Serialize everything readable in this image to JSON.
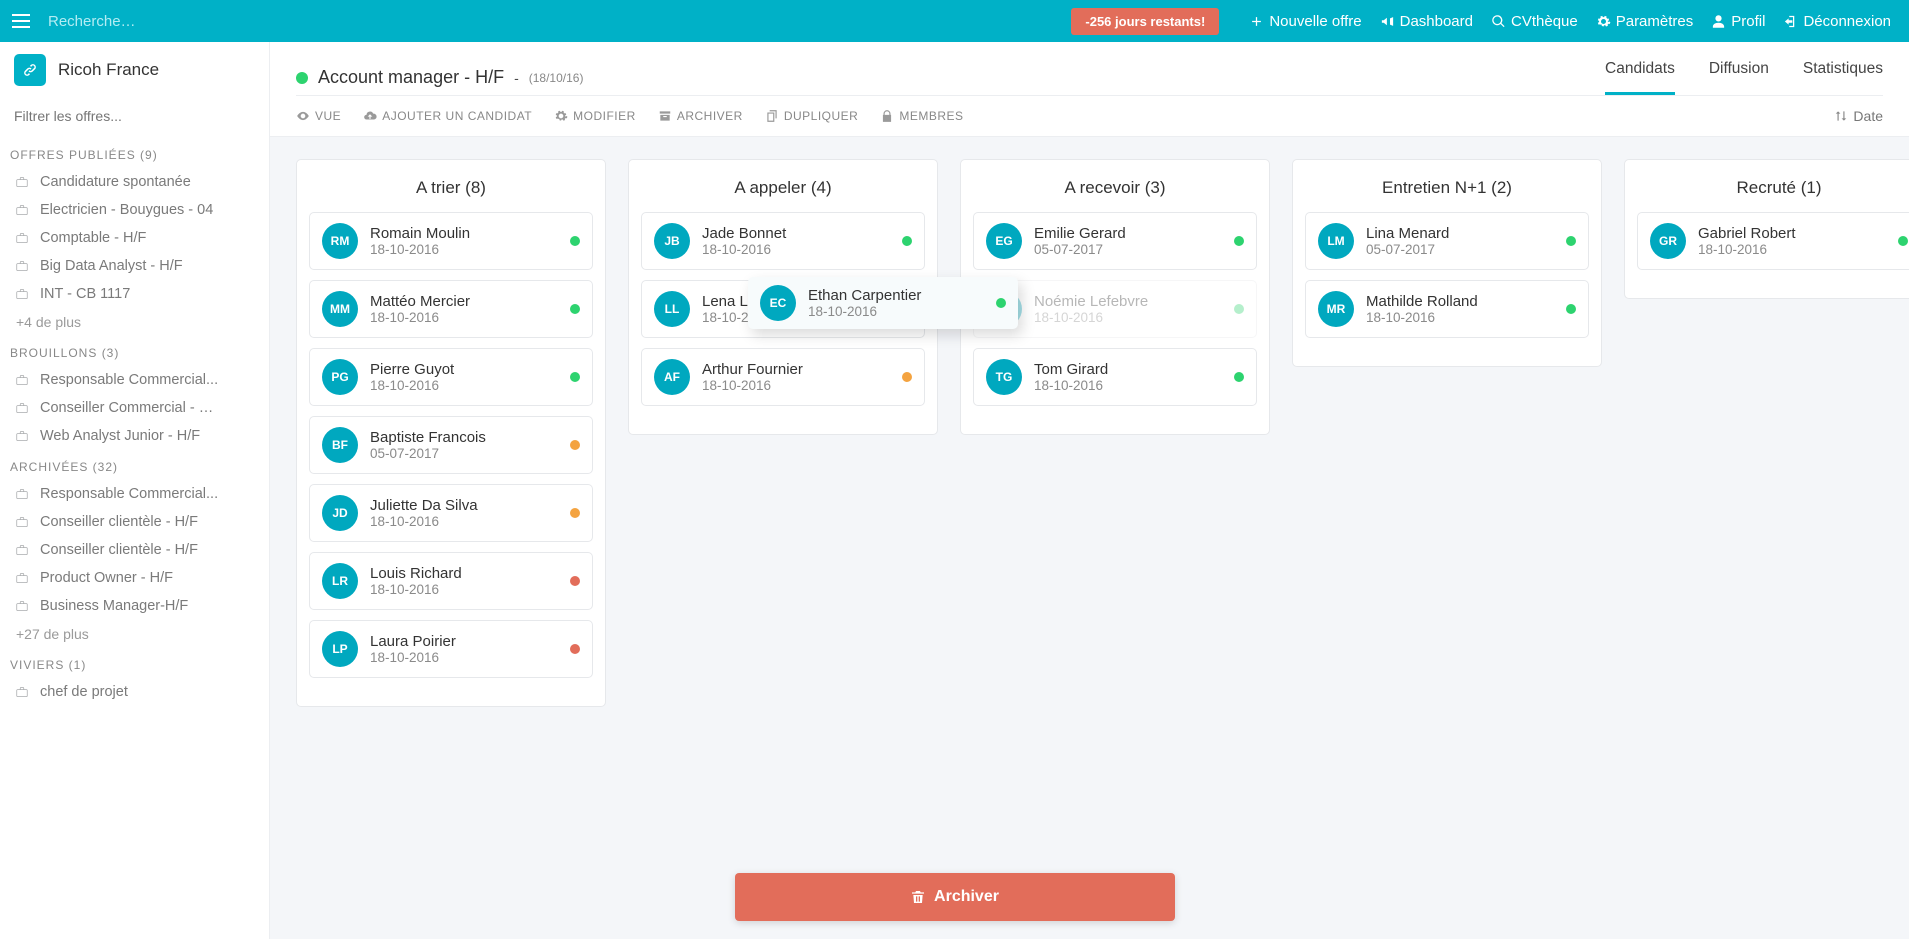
{
  "topbar": {
    "search_placeholder": "Recherche…",
    "days_badge": "-256 jours restants!",
    "nav": {
      "nouvelle": "Nouvelle offre",
      "dashboard": "Dashboard",
      "cv": "CVthèque",
      "params": "Paramètres",
      "profil": "Profil",
      "logout": "Déconnexion"
    }
  },
  "sidebar": {
    "org": "Ricoh France",
    "filter_placeholder": "Filtrer les offres...",
    "sections": {
      "publiees": {
        "title": "OFFRES PUBLIÉES (9)",
        "items": [
          "Candidature spontanée",
          "Electricien - Bouygues - 04",
          "Comptable - H/F",
          "Big Data Analyst - H/F",
          "INT - CB 1117"
        ],
        "more": "+4 de plus"
      },
      "brouillons": {
        "title": "BROUILLONS (3)",
        "items": [
          "Responsable Commercial...",
          "Conseiller Commercial - …",
          "Web Analyst Junior - H/F"
        ]
      },
      "archivees": {
        "title": "ARCHIVÉES (32)",
        "items": [
          "Responsable Commercial...",
          "Conseiller clientèle - H/F",
          "Conseiller clientèle - H/F",
          "Product Owner - H/F",
          "Business Manager-H/F"
        ],
        "more": "+27 de plus"
      },
      "viviers": {
        "title": "VIVIERS (1)",
        "items": [
          "chef de projet"
        ]
      }
    }
  },
  "job": {
    "title": "Account manager - H/F",
    "date": "(18/10/16)",
    "tabs": {
      "candidats": "Candidats",
      "diffusion": "Diffusion",
      "stats": "Statistiques"
    }
  },
  "toolbar": {
    "vue": "VUE",
    "ajouter": "AJOUTER UN CANDIDAT",
    "modifier": "MODIFIER",
    "archiver": "ARCHIVER",
    "dupliquer": "DUPLIQUER",
    "membres": "MEMBRES",
    "sort": "Date"
  },
  "kanban": {
    "columns": [
      {
        "id": "trier",
        "title": "A trier (8)",
        "cards": [
          {
            "init": "RM",
            "name": "Romain Moulin",
            "date": "18-10-2016",
            "dot": "green"
          },
          {
            "init": "MM",
            "name": "Mattéo Mercier",
            "date": "18-10-2016",
            "dot": "green"
          },
          {
            "init": "PG",
            "name": "Pierre Guyot",
            "date": "18-10-2016",
            "dot": "green"
          },
          {
            "init": "BF",
            "name": "Baptiste Francois",
            "date": "05-07-2017",
            "dot": "orange"
          },
          {
            "init": "JD",
            "name": "Juliette Da Silva",
            "date": "18-10-2016",
            "dot": "orange"
          },
          {
            "init": "LR",
            "name": "Louis Richard",
            "date": "18-10-2016",
            "dot": "red"
          },
          {
            "init": "LP",
            "name": "Laura Poirier",
            "date": "18-10-2016",
            "dot": "red"
          }
        ]
      },
      {
        "id": "appeler",
        "title": "A appeler (4)",
        "cards": [
          {
            "init": "JB",
            "name": "Jade Bonnet",
            "date": "18-10-2016",
            "dot": "green"
          },
          {
            "init": "LL",
            "name": "Lena Lucas",
            "date": "18-10-2016",
            "dot": "orange"
          },
          {
            "init": "AF",
            "name": "Arthur Fournier",
            "date": "18-10-2016",
            "dot": "orange"
          }
        ]
      },
      {
        "id": "recevoir",
        "title": "A recevoir (3)",
        "cards": [
          {
            "init": "EG",
            "name": "Emilie Gerard",
            "date": "05-07-2017",
            "dot": "green"
          },
          {
            "init": "NL",
            "name": "Noémie Lefebvre",
            "date": "18-10-2016",
            "dot": "green",
            "faded": true
          },
          {
            "init": "TG",
            "name": "Tom Girard",
            "date": "18-10-2016",
            "dot": "green"
          }
        ]
      },
      {
        "id": "entretien",
        "title": "Entretien N+1 (2)",
        "cards": [
          {
            "init": "LM",
            "name": "Lina Menard",
            "date": "05-07-2017",
            "dot": "green"
          },
          {
            "init": "MR",
            "name": "Mathilde Rolland",
            "date": "18-10-2016",
            "dot": "green"
          }
        ]
      },
      {
        "id": "recrute",
        "title": "Recruté (1)",
        "cards": [
          {
            "init": "GR",
            "name": "Gabriel Robert",
            "date": "18-10-2016",
            "dot": "green"
          }
        ]
      }
    ],
    "drag": {
      "init": "EC",
      "name": "Ethan Carpentier",
      "date": "18-10-2016",
      "dot": "green"
    }
  },
  "archive_button": "Archiver"
}
